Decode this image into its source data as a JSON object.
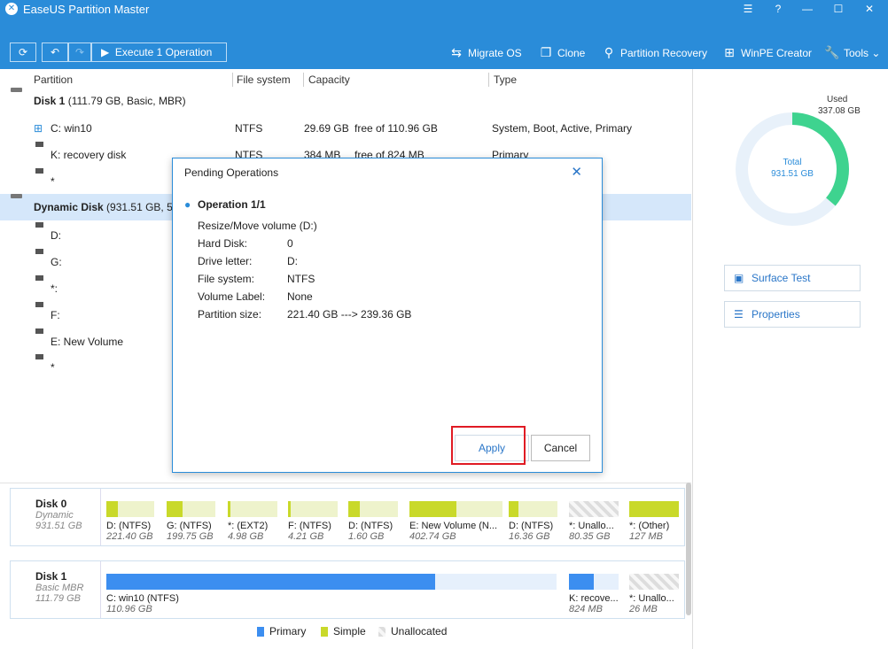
{
  "app": {
    "title": "EaseUS Partition Master"
  },
  "titlebar_buttons": [
    "☰",
    "?",
    "—",
    "☐",
    "✕"
  ],
  "toolbar": {
    "execute_label": "Execute 1 Operation",
    "tools": [
      {
        "label": "Migrate OS",
        "icon": "migrate-icon"
      },
      {
        "label": "Clone",
        "icon": "clone-icon"
      },
      {
        "label": "Partition Recovery",
        "icon": "recovery-icon"
      },
      {
        "label": "WinPE Creator",
        "icon": "winpe-icon"
      },
      {
        "label": "Tools",
        "icon": "tools-icon"
      }
    ]
  },
  "columns": {
    "partition": "Partition",
    "filesystem": "File system",
    "capacity": "Capacity",
    "type": "Type"
  },
  "rows": {
    "disk1": {
      "name": "Disk 1",
      "detail": "(111.79 GB, Basic, MBR)"
    },
    "c": {
      "name": "C: win10",
      "fs": "NTFS",
      "cap": "29.69 GB",
      "free": "free of 110.96 GB",
      "type": "System, Boot, Active, Primary"
    },
    "k": {
      "name": "K: recovery disk",
      "fs": "NTFS",
      "cap": "384 MB",
      "free": "free of 824 MB",
      "type": "Primary"
    },
    "star1": {
      "name": "*"
    },
    "dyn": {
      "name": "Dynamic Disk",
      "detail": "(931.51 GB, 51"
    },
    "d": {
      "name": "D:"
    },
    "g": {
      "name": "G:"
    },
    "s": {
      "name": "*:"
    },
    "f": {
      "name": "F:"
    },
    "e": {
      "name": "E: New Volume"
    },
    "star2": {
      "name": "*"
    }
  },
  "chart": {
    "used_label": "Used",
    "used": "337.08 GB",
    "total_label": "Total",
    "total": "931.51 GB",
    "used_fraction": 0.362
  },
  "actions": {
    "surface_test": "Surface Test",
    "properties": "Properties"
  },
  "dialog": {
    "title": "Pending Operations",
    "operation": "Operation 1/1",
    "summary": "Resize/Move volume (D:)",
    "fields": [
      {
        "label": "Hard Disk:",
        "value": "0"
      },
      {
        "label": "Drive letter:",
        "value": "D:"
      },
      {
        "label": "File system:",
        "value": "NTFS"
      },
      {
        "label": "Volume Label:",
        "value": "None"
      },
      {
        "label": "Partition size:",
        "value": "221.40 GB ---> 239.36 GB"
      }
    ],
    "apply": "Apply",
    "cancel": "Cancel"
  },
  "disk0": {
    "name": "Disk 0",
    "type": "Dynamic",
    "size": "931.51 GB",
    "segments": [
      {
        "label": "D: (NTFS)",
        "size": "221.40 GB",
        "fill": 0.24
      },
      {
        "label": "G: (NTFS)",
        "size": "199.75 GB",
        "fill": 0.33
      },
      {
        "label": "*: (EXT2)",
        "size": "4.98 GB",
        "fill": 0.05
      },
      {
        "label": "F: (NTFS)",
        "size": "4.21 GB",
        "fill": 0.05
      },
      {
        "label": "D: (NTFS)",
        "size": "1.60 GB",
        "fill": 0.24
      },
      {
        "label": "E: New Volume (N...",
        "size": "402.74 GB",
        "fill": 0.5
      },
      {
        "label": "D: (NTFS)",
        "size": "16.36 GB",
        "fill": 0.2
      },
      {
        "label": "*: Unallo...",
        "size": "80.35 GB",
        "fill": 0
      },
      {
        "label": "*: (Other)",
        "size": "127 MB",
        "fill": 1
      }
    ]
  },
  "disk1card": {
    "name": "Disk 1",
    "type": "Basic MBR",
    "size": "111.79 GB",
    "segments": [
      {
        "label": "C: win10 (NTFS)",
        "size": "110.96 GB",
        "fill": 0.73
      },
      {
        "label": "K: recove...",
        "size": "824 MB",
        "fill": 0.5
      },
      {
        "label": "*: Unallo...",
        "size": "26 MB",
        "fill": 0
      }
    ]
  },
  "legend": {
    "primary": "Primary",
    "simple": "Simple",
    "unallocated": "Unallocated"
  },
  "colors": {
    "accent": "#2a8cd9",
    "primary": "#3c8ef0",
    "simple": "#c9d92a",
    "donut_used": "#3ed38f",
    "donut_bg": "#e8f1fa",
    "highlight": "#e01b24"
  }
}
